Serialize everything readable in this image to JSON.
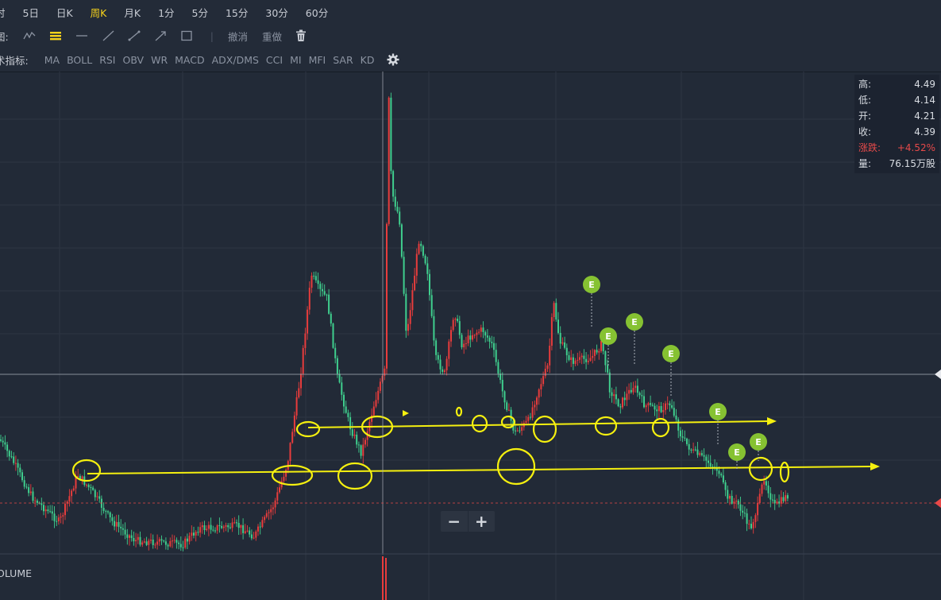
{
  "toolbar": {
    "periods": [
      {
        "label": "分时",
        "display": "时",
        "active": false
      },
      {
        "label": "5日",
        "active": false
      },
      {
        "label": "日K",
        "active": false
      },
      {
        "label": "周K",
        "active": true
      },
      {
        "label": "月K",
        "active": false
      },
      {
        "label": "1分",
        "active": false
      },
      {
        "label": "5分",
        "active": false
      },
      {
        "label": "15分",
        "active": false
      },
      {
        "label": "30分",
        "active": false
      },
      {
        "label": "60分",
        "active": false
      }
    ],
    "draw_label": "绘图:",
    "draw_label_display": "图:",
    "draw_tools": [
      "polyline-icon",
      "parallel-lines-icon",
      "horizontal-line-icon",
      "ray-line-icon",
      "segment-line-icon",
      "arrow-line-icon",
      "rectangle-icon"
    ],
    "undo_label": "撤消",
    "redo_label": "重做",
    "delete_icon": "trash-icon",
    "indicator_label": "技术指标:",
    "indicator_label_display": "术指标:",
    "indicators": [
      "MA",
      "BOLL",
      "RSI",
      "OBV",
      "WR",
      "MACD",
      "ADX/DMS",
      "CCI",
      "MI",
      "MFI",
      "SAR",
      "KD"
    ],
    "settings_icon": "gear-icon"
  },
  "info_panel": {
    "high_label": "高:",
    "high": "4.49",
    "low_label": "低:",
    "low": "4.14",
    "open_label": "开:",
    "open": "4.21",
    "close_label": "收:",
    "close": "4.39",
    "change_label": "涨跌:",
    "change": "+4.52%",
    "volume_label": "量:",
    "volume": "76.15万股"
  },
  "zoom": {
    "minus": "−",
    "plus": "+"
  },
  "volume_label": "VOLUME",
  "volume_label_display": "OLUME",
  "colors": {
    "up": "#e83c3c",
    "down": "#3fcf8e",
    "annotation": "#f5f00f",
    "event_badge": "#86c232",
    "background": "#222a37",
    "active_period": "#f6d21b"
  },
  "chart_data": {
    "type": "candlestick",
    "period": "周K",
    "last_bar": {
      "high": 4.49,
      "low": 4.14,
      "open": 4.21,
      "close": 4.39,
      "change_pct": 4.52
    },
    "series_shape": [
      {
        "phase": "pre-2020",
        "price_level": "low (~3.3–3.9)"
      },
      {
        "phase": "first spike",
        "peak": "~7.3"
      },
      {
        "phase": "major spike",
        "peak": "~9.2"
      },
      {
        "phase": "consolidation",
        "range": "~5.0–6.2"
      },
      {
        "phase": "decline",
        "trough": "~3.6"
      },
      {
        "phase": "recent",
        "last": 4.39
      }
    ],
    "annotations": {
      "event_badges": [
        {
          "label": "E"
        },
        {
          "label": "E"
        },
        {
          "label": "E"
        },
        {
          "label": "E"
        },
        {
          "label": "E"
        },
        {
          "label": "E"
        },
        {
          "label": "E"
        }
      ],
      "support_lines": 2,
      "highlight_ellipses": 15
    }
  }
}
